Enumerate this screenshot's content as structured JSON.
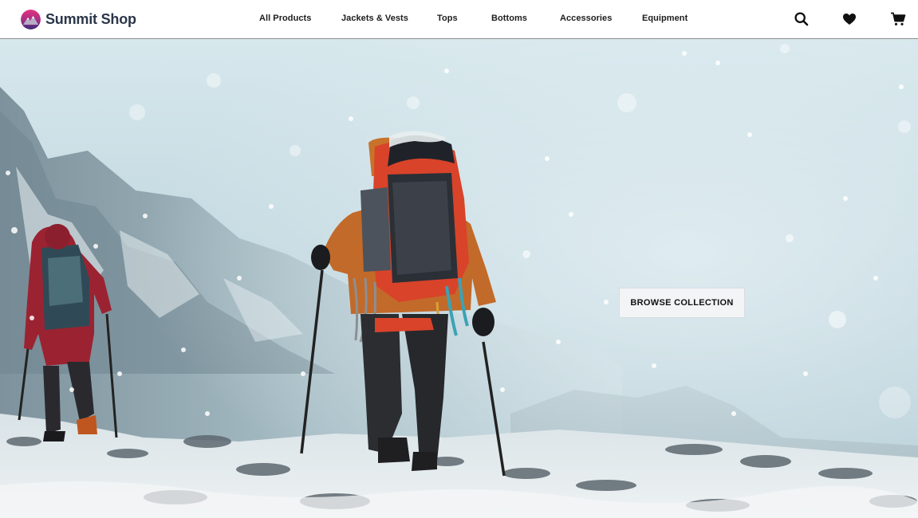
{
  "brand": {
    "name": "Summit Shop",
    "logo_icon": "mountain-logo-icon"
  },
  "nav": {
    "links": [
      {
        "label": "All Products"
      },
      {
        "label": "Jackets & Vests"
      },
      {
        "label": "Tops"
      },
      {
        "label": "Bottoms"
      },
      {
        "label": "Accessories"
      },
      {
        "label": "Equipment"
      }
    ],
    "icons": [
      "search-icon",
      "heart-icon",
      "cart-icon"
    ]
  },
  "hero": {
    "image": "mountaineers-hiking-in-snowstorm",
    "cta_label": "BROWSE COLLECTION"
  },
  "colors": {
    "brand_text": "#2b3649",
    "logo_gradient_top": "#e4317d",
    "logo_gradient_bottom": "#3a2a7a",
    "navbar_bg": "#ffffff",
    "hero_sky": "#c6dde4"
  }
}
